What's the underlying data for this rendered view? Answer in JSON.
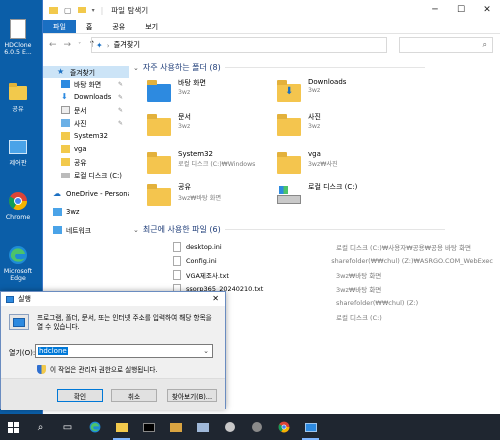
{
  "desktop": {
    "icons": [
      {
        "label": "HDClone 6.0.5 E...",
        "icon": "hdclone-icon"
      },
      {
        "label": "공유",
        "icon": "folder-icon"
      },
      {
        "label": "제어판",
        "icon": "control-panel-icon"
      },
      {
        "label": "Chrome",
        "icon": "chrome-icon"
      },
      {
        "label": "Microsoft Edge",
        "icon": "edge-icon"
      }
    ]
  },
  "explorer": {
    "title": "파일 탐색기",
    "ribbon_tabs": [
      "파일",
      "홈",
      "공유",
      "보기"
    ],
    "address": "즐겨찾기",
    "nav": [
      {
        "label": "즐겨찾기",
        "selected": true,
        "pinned": false
      },
      {
        "label": "바탕 화면",
        "selected": false,
        "pinned": true
      },
      {
        "label": "Downloads",
        "selected": false,
        "pinned": true
      },
      {
        "label": "문서",
        "selected": false,
        "pinned": true
      },
      {
        "label": "사진",
        "selected": false,
        "pinned": true
      },
      {
        "label": "System32",
        "selected": false,
        "pinned": false
      },
      {
        "label": "vga",
        "selected": false,
        "pinned": false
      },
      {
        "label": "공유",
        "selected": false,
        "pinned": false
      },
      {
        "label": "로컬 디스크 (C:)",
        "selected": false,
        "pinned": false
      },
      {
        "label": "OneDrive - Personal",
        "selected": false,
        "pinned": false
      },
      {
        "label": "3wz",
        "selected": false,
        "pinned": false
      },
      {
        "label": "네트워크",
        "selected": false,
        "pinned": false
      }
    ],
    "frequent_header": "자주 사용하는 폴더 (8)",
    "frequent": [
      {
        "name": "바탕 화면",
        "sub": "3wz"
      },
      {
        "name": "Downloads",
        "sub": "3wz"
      },
      {
        "name": "문서",
        "sub": "3wz"
      },
      {
        "name": "사진",
        "sub": "3wz"
      },
      {
        "name": "System32",
        "sub": "로컬 디스크 (C:)₩Windows"
      },
      {
        "name": "vga",
        "sub": "3wz₩사진"
      },
      {
        "name": "공유",
        "sub": "3wz₩바탕 화면"
      },
      {
        "name": "로컬 디스크 (C:)",
        "sub": ""
      }
    ],
    "recent_header": "최근에 사용한 파일 (6)",
    "recent": [
      {
        "name": "desktop.ini",
        "location": "로컬 디스크 (C:)₩사용자₩공용₩공용 바탕 화면"
      },
      {
        "name": "Config.ini",
        "location": "sharefolder(₩₩chul) (Z:)₩ASRGO.COM_WebExec"
      },
      {
        "name": "VGA제조사.txt",
        "location": "3wz₩바탕 화면"
      },
      {
        "name": "ssorp365_20240210.txt",
        "location": "3wz₩바탕 화면"
      },
      {
        "name": "",
        "location": "sharefolder(₩₩chul) (Z:)"
      },
      {
        "name": "",
        "location": "로컬 디스크 (C:)"
      }
    ]
  },
  "run_dialog": {
    "title": "실행",
    "description": "프로그램, 폴더, 문서, 또는 인터넷 주소를 입력하여 해당 항목을 열 수 있습니다.",
    "open_label": "열기(O):",
    "input_value": "hdclone",
    "admin_note": "이 작업은 관리자 권한으로 실행됩니다.",
    "ok_label": "확인",
    "cancel_label": "취소",
    "browse_label": "찾아보기(B)..."
  },
  "taskbar": {
    "items": [
      "start-icon",
      "search-icon",
      "task-view-icon",
      "edge-icon",
      "explorer-icon",
      "terminal-icon",
      "app-icon",
      "mail-icon",
      "app2-icon",
      "app3-icon",
      "chrome-icon",
      "folder-icon"
    ]
  }
}
